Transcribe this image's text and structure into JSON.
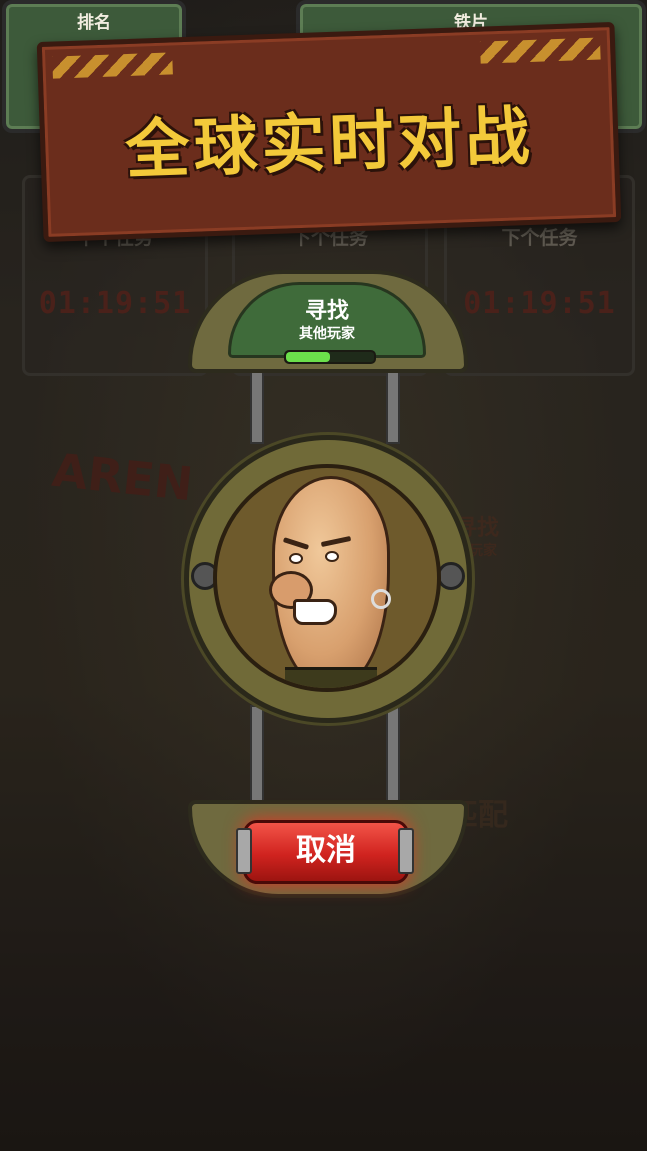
{
  "hud": {
    "rank_label": "排名",
    "iron_label": "铁片"
  },
  "background": {
    "panels": [
      {
        "title": "下个任务",
        "timer": "01:19:51"
      },
      {
        "title": "下个任务",
        "timer": ""
      },
      {
        "title": "下个任务",
        "timer": "01:19:51"
      }
    ],
    "arena_sign": "AREN",
    "side_search_title": "寻找",
    "side_search_sub": "他玩家",
    "match_label": "匹配"
  },
  "banner": {
    "title": "全球实时对战"
  },
  "matchmaking": {
    "title": "寻找",
    "subtitle": "其他玩家",
    "progress_fraction": 0.5,
    "cancel_label": "取消"
  },
  "colors": {
    "banner_bg": "#6b2d1c",
    "banner_text": "#f3c93a",
    "search_green": "#3f6b3a",
    "progress_green": "#6be04b",
    "cancel_red": "#d0231f"
  }
}
